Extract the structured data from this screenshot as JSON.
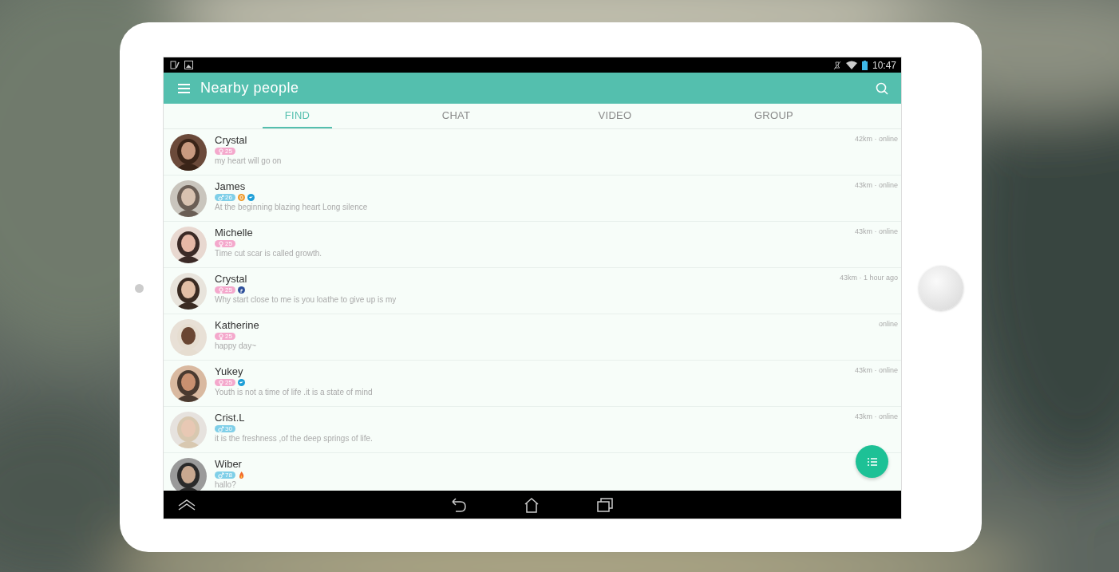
{
  "status_bar": {
    "time": "10:47"
  },
  "app_bar": {
    "title": "Nearby people"
  },
  "tabs": [
    {
      "label": "FIND",
      "selected": true
    },
    {
      "label": "CHAT",
      "selected": false
    },
    {
      "label": "VIDEO",
      "selected": false
    },
    {
      "label": "GROUP",
      "selected": false
    }
  ],
  "people": [
    {
      "name": "Crystal",
      "badge": {
        "kind": "female",
        "age": "25"
      },
      "motto": "my heart will go on",
      "distance": "42km · online"
    },
    {
      "name": "James",
      "badge": {
        "kind": "male",
        "age": "26"
      },
      "icons": [
        {
          "kind": "coin"
        },
        {
          "kind": "bird"
        }
      ],
      "motto": "At the beginning blazing heart Long silence",
      "distance": "43km · online"
    },
    {
      "name": "Michelle",
      "badge": {
        "kind": "female",
        "age": "25"
      },
      "motto": "Time cut scar is called growth.",
      "distance": "43km · online"
    },
    {
      "name": "Crystal",
      "badge": {
        "kind": "female",
        "age": "25"
      },
      "icons": [
        {
          "kind": "facebook"
        }
      ],
      "motto": "Why start close to me is you loathe to give up is my",
      "distance": "43km · 1 hour ago"
    },
    {
      "name": "Katherine",
      "badge": {
        "kind": "female",
        "age": "25"
      },
      "motto": "happy day~",
      "distance": "online"
    },
    {
      "name": "Yukey",
      "badge": {
        "kind": "female",
        "age": "25"
      },
      "icons": [
        {
          "kind": "bird"
        }
      ],
      "motto": "Youth is not a time of life .it is a state of mind",
      "distance": "43km · online"
    },
    {
      "name": "Crist.L",
      "badge": {
        "kind": "male",
        "age": "30"
      },
      "motto": "it is the freshness ,of the deep springs of life.",
      "distance": "43km · online"
    },
    {
      "name": "Wiber",
      "badge": {
        "kind": "male",
        "age": "78"
      },
      "icons": [
        {
          "kind": "flame"
        }
      ],
      "motto": "hallo?"
    }
  ]
}
